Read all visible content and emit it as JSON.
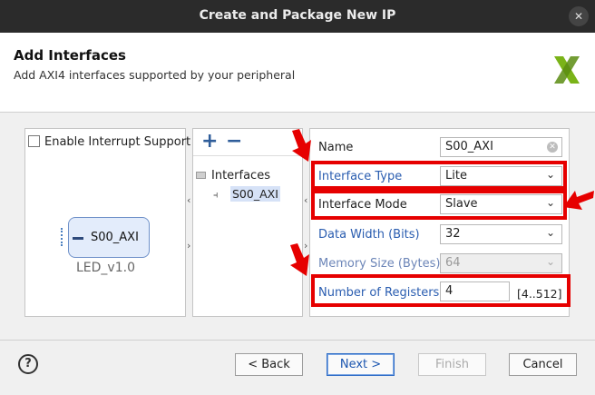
{
  "window": {
    "title": "Create and Package New IP",
    "close_glyph": "✕"
  },
  "header": {
    "title": "Add Interfaces",
    "subtitle": "Add AXI4 interfaces supported by your peripheral",
    "logo_icon": "xilinx-logo-icon"
  },
  "block_panel": {
    "enable_interrupt_label": "Enable Interrupt Support",
    "enable_interrupt_checked": false,
    "port_label": "S00_AXI",
    "ip_name": "LED_v1.0"
  },
  "tree": {
    "add_glyph": "+",
    "remove_glyph": "−",
    "root_label": "Interfaces",
    "items": [
      {
        "label": "S00_AXI",
        "selected": true
      }
    ]
  },
  "properties": {
    "name_label": "Name",
    "name_value": "S00_AXI",
    "interface_type_label": "Interface Type",
    "interface_type_value": "Lite",
    "interface_mode_label": "Interface Mode",
    "interface_mode_value": "Slave",
    "data_width_label": "Data Width (Bits)",
    "data_width_value": "32",
    "memory_size_label": "Memory Size (Bytes)",
    "memory_size_value": "64",
    "num_registers_label": "Number of Registers",
    "num_registers_value": "4",
    "num_registers_range": "[4..512]"
  },
  "footer": {
    "help_glyph": "?",
    "back_label": "< Back",
    "next_label": "Next >",
    "finish_label": "Finish",
    "cancel_label": "Cancel"
  },
  "colors": {
    "highlight_red": "#e60000",
    "link_blue": "#2a5db0",
    "titlebar": "#2b2b2b"
  }
}
